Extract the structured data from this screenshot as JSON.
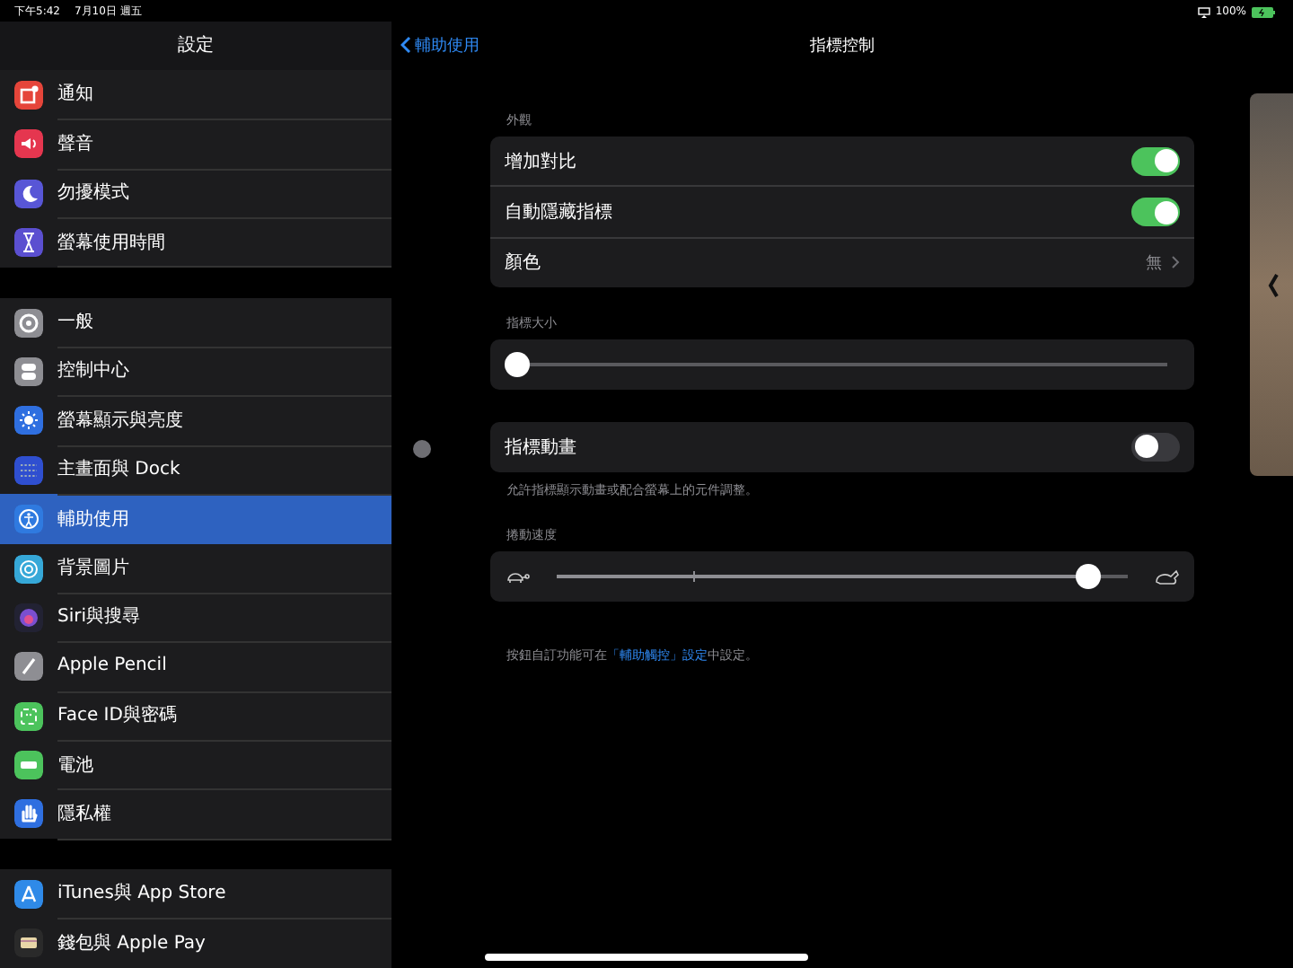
{
  "status_bar": {
    "time": "下午5:42",
    "date": "7月10日 週五",
    "battery": "100%"
  },
  "sidebar": {
    "title": "設定",
    "groups": [
      [
        {
          "label": "通知",
          "color": "#e5453a",
          "selected": false
        },
        {
          "label": "聲音",
          "color": "#e5364f",
          "selected": false
        },
        {
          "label": "勿擾模式",
          "color": "#5856d6",
          "selected": false
        },
        {
          "label": "螢幕使用時間",
          "color": "#5b4fd0",
          "selected": false
        }
      ],
      [
        {
          "label": "一般",
          "color": "#8e8e93",
          "selected": false
        },
        {
          "label": "控制中心",
          "color": "#8e8e93",
          "selected": false
        },
        {
          "label": "螢幕顯示與亮度",
          "color": "#2f6fe0",
          "selected": false
        },
        {
          "label": "主畫面與 Dock",
          "color": "#2f4fd0",
          "selected": false
        },
        {
          "label": "輔助使用",
          "color": "#2f7ae0",
          "selected": true
        },
        {
          "label": "背景圖片",
          "color": "#36a8d8",
          "selected": false
        },
        {
          "label": "Siri與搜尋",
          "color": "#222233",
          "selected": false
        },
        {
          "label": "Apple Pencil",
          "color": "#8e8e93",
          "selected": false
        },
        {
          "label": "Face ID與密碼",
          "color": "#4cc35c",
          "selected": false
        },
        {
          "label": "電池",
          "color": "#4cc35c",
          "selected": false
        },
        {
          "label": "隱私權",
          "color": "#2f6fe0",
          "selected": false
        }
      ],
      [
        {
          "label": "iTunes與 App Store",
          "color": "#2f8ae8",
          "selected": false
        },
        {
          "label": "錢包與 Apple Pay",
          "color": "#2a2a2a",
          "selected": false
        }
      ]
    ]
  },
  "nav": {
    "back": "輔助使用",
    "title": "指標控制"
  },
  "sections": [
    {
      "kind": "toggles",
      "header": "外觀",
      "rows": [
        {
          "kind": "toggle",
          "label": "增加對比",
          "on": true
        },
        {
          "kind": "toggle",
          "label": "自動隱藏指標",
          "on": true
        },
        {
          "kind": "detail",
          "label": "顏色",
          "value": "無"
        }
      ]
    },
    {
      "kind": "slider",
      "header": "指標大小",
      "level": 0
    },
    {
      "kind": "toggles",
      "rows": [
        {
          "kind": "toggle",
          "label": "指標動畫",
          "on": false
        }
      ],
      "footer": "允許指標顯示動畫或配合螢幕上的元件調整。"
    },
    {
      "kind": "speed_slider",
      "header": "捲動速度",
      "level": 0.93
    }
  ],
  "note": {
    "before": "按鈕自訂功能可在",
    "link": "「輔助觸控」設定",
    "after": "中設定。"
  }
}
